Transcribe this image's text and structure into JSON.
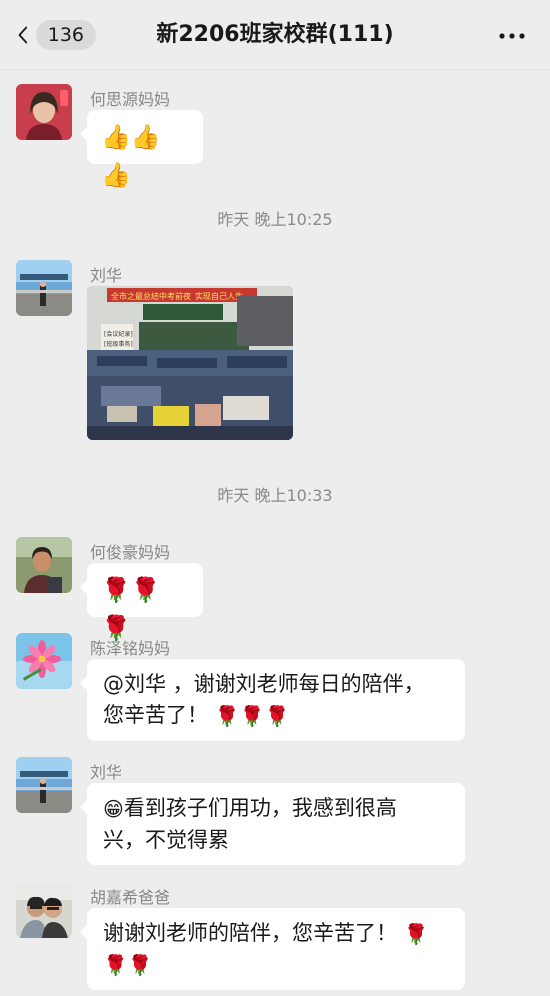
{
  "header": {
    "unread_count": "136",
    "title": "新2206班家校群(111)"
  },
  "messages": [
    {
      "sender": "何思源妈妈",
      "content": "👍👍👍"
    },
    {
      "timestamp": "昨天 晚上10:25"
    },
    {
      "sender": "刘华",
      "content_type": "image"
    },
    {
      "timestamp": "昨天 晚上10:33"
    },
    {
      "sender": "何俊豪妈妈",
      "content": "🌹🌹🌹"
    },
    {
      "sender": "陈泽铭妈妈",
      "line1": "@刘华 ，谢谢刘老师每日的陪伴，",
      "line2": "您辛苦了！"
    },
    {
      "sender": "刘华",
      "line1": "看到孩子们用功，我感到很高",
      "line2": "兴，不觉得累"
    },
    {
      "sender": "胡嘉希爸爸",
      "line1": "谢谢刘老师的陪伴，您辛苦了！"
    }
  ],
  "photo_banner": {
    "left": "全市之最总结中考前夜",
    "right": "实现自己人生"
  },
  "photo_board": {
    "line1": "[会议纪录]",
    "line2": "[班级事务]"
  }
}
